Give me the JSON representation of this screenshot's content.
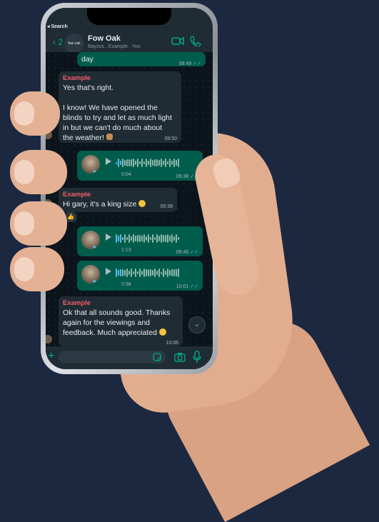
{
  "header": {
    "search_label": "Search",
    "back_count": "2",
    "avatar_text": "fow oak",
    "name": "Fow Oak",
    "subtitle": "Bayzos , Example , You"
  },
  "messages": {
    "m0": {
      "text": "day",
      "time": "08:49"
    },
    "m1": {
      "sender": "Example",
      "text_line1": "Yes that's right.",
      "text_line2": "I know! We have opened the",
      "text_line3": "blinds to try and let as much light",
      "text_line4": "in but we can't do much about",
      "text_line5": "the weather!",
      "time": "08:50"
    },
    "v1": {
      "duration": "0:04",
      "time": "09:38"
    },
    "m2": {
      "sender": "Example",
      "text": "Hi gary, it's a king size",
      "time": "09:38",
      "reaction": "👍"
    },
    "v2": {
      "duration": "1:13",
      "time": "09:45"
    },
    "v3": {
      "duration": "0:38",
      "time": "10:01"
    },
    "m3": {
      "sender": "Example",
      "text_line1": "Ok that all sounds good. Thanks",
      "text_line2": "again for the viewings and",
      "text_line3": "feedback. Much appreciated",
      "time": "10:06"
    }
  },
  "footer": {
    "plus": "+"
  },
  "icons": [
    "video-call-icon",
    "phone-call-icon",
    "play-icon",
    "mic-icon",
    "sticker-icon",
    "camera-icon",
    "chevron-down-icon"
  ]
}
